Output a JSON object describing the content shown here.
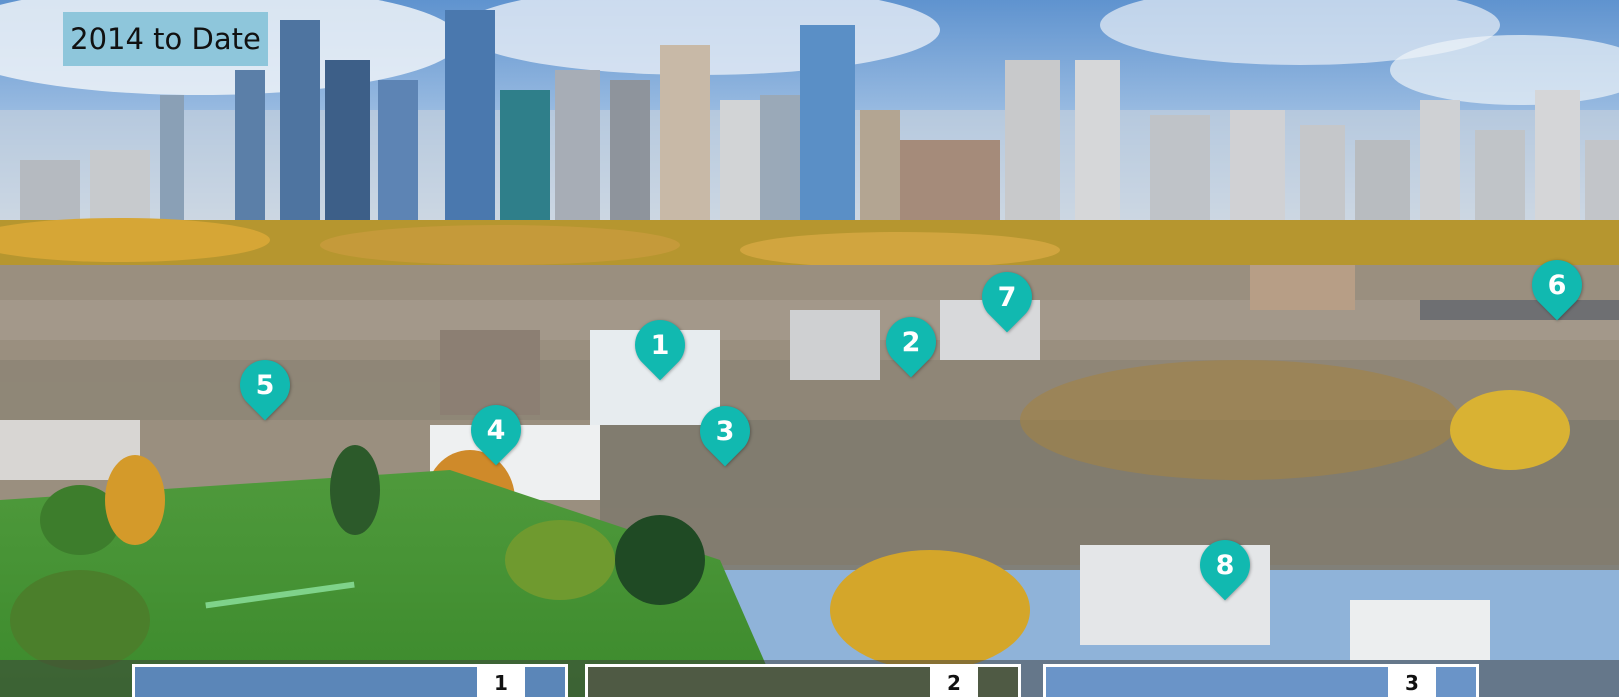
{
  "title": "2014 to Date",
  "pins": [
    {
      "label": "1"
    },
    {
      "label": "2"
    },
    {
      "label": "3"
    },
    {
      "label": "4"
    },
    {
      "label": "5"
    },
    {
      "label": "6"
    },
    {
      "label": "7"
    },
    {
      "label": "8"
    }
  ],
  "cards": [
    {
      "label": "1"
    },
    {
      "label": "2"
    },
    {
      "label": "3"
    }
  ],
  "colors": {
    "pin": "#11b9b0",
    "title_box": "#8ec6db"
  }
}
